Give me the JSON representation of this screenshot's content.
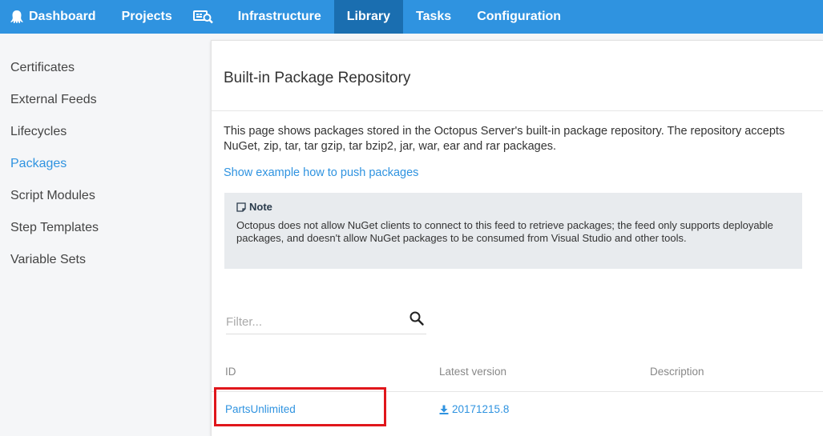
{
  "nav": {
    "items": [
      {
        "label": "Dashboard",
        "icon": "octopus-icon"
      },
      {
        "label": "Projects"
      },
      {
        "label": "",
        "icon": "machines-icon"
      },
      {
        "label": "Infrastructure"
      },
      {
        "label": "Library",
        "active": true
      },
      {
        "label": "Tasks"
      },
      {
        "label": "Configuration"
      }
    ]
  },
  "sidebar": {
    "items": [
      {
        "label": "Certificates"
      },
      {
        "label": "External Feeds"
      },
      {
        "label": "Lifecycles"
      },
      {
        "label": "Packages",
        "active": true
      },
      {
        "label": "Script Modules"
      },
      {
        "label": "Step Templates"
      },
      {
        "label": "Variable Sets"
      }
    ]
  },
  "main": {
    "title": "Built-in Package Repository",
    "description": "This page shows packages stored in the Octopus Server's built-in package repository. The repository accepts NuGet, zip, tar, tar gzip, tar bzip2, jar, war, ear and rar packages.",
    "push_link": "Show example how to push packages",
    "note": {
      "title": "Note",
      "body": "Octopus does not allow NuGet clients to connect to this feed to retrieve packages; the feed only supports deployable packages, and doesn't allow NuGet packages to be consumed from Visual Studio and other tools."
    },
    "filter": {
      "placeholder": "Filter...",
      "value": ""
    },
    "table": {
      "headers": {
        "id": "ID",
        "version": "Latest version",
        "description": "Description"
      },
      "rows": [
        {
          "id": "PartsUnlimited",
          "version": "20171215.8",
          "description": ""
        }
      ]
    }
  },
  "colors": {
    "accent": "#2f93e0",
    "nav_active": "#1a6eb0",
    "highlight": "#e0161b"
  }
}
